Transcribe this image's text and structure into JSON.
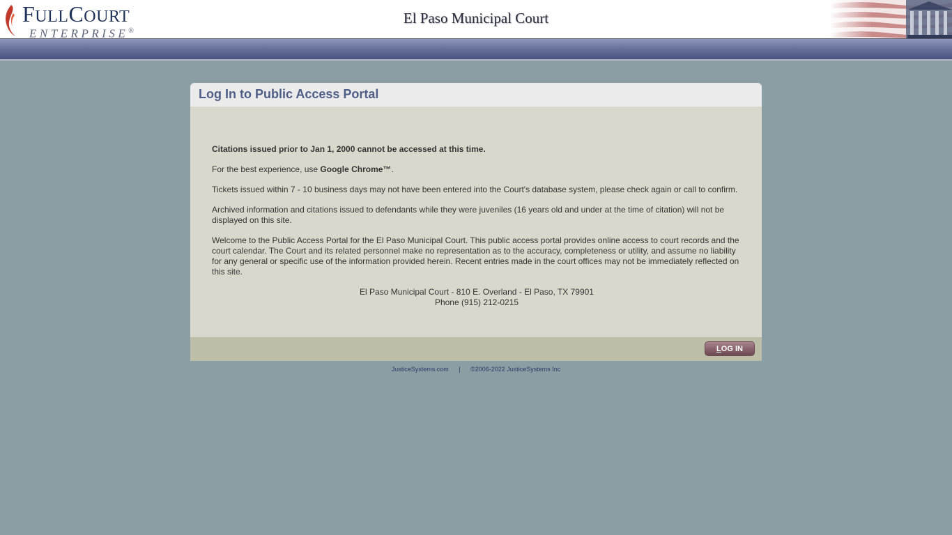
{
  "header": {
    "logo_main_first": "F",
    "logo_main_rest": "ULL",
    "logo_main_second": "C",
    "logo_main_second_rest": "OURT",
    "logo_sub": "ENTERPRISE",
    "logo_sub_mark": "®",
    "court_title": "El Paso Municipal Court"
  },
  "panel": {
    "title": "Log In to Public Access Portal",
    "notice_bold": "Citations issued prior to Jan 1, 2000 cannot be accessed at this time.",
    "browser_prefix": "For the best experience, use ",
    "browser_name": "Google Chrome™",
    "browser_suffix": ".",
    "tickets_text": "Tickets issued within 7 - 10 business days may not have been entered into the Court's database system, please check again or call to confirm.",
    "archived_text": "Archived information and citations issued to defendants while they were juveniles (16 years old and under at the time of citation) will not be displayed on this site.",
    "welcome_text": "Welcome to the Public Access Portal for the El Paso Municipal Court. This public access portal provides online access to court records and the court calendar. The Court and its related personnel make no representation as to the accuracy, completeness or utility, and assume no liability for any general or specific use of the information provided herein. Recent entries made in the court offices may not be immediately reflected on this site.",
    "address": "El Paso Municipal Court - 810 E. Overland - El Paso, TX 79901",
    "phone": "Phone (915) 212-0215",
    "login_first": "L",
    "login_rest": "OG IN"
  },
  "footer": {
    "link": "JusticeSystems.com",
    "separator": "|",
    "copyright": "©2006-2022 JusticeSystems Inc"
  },
  "colors": {
    "accent_navy": "#1e3158",
    "flame_red": "#c0392b",
    "panel_title": "#4e5e86",
    "button": "#87616c"
  }
}
